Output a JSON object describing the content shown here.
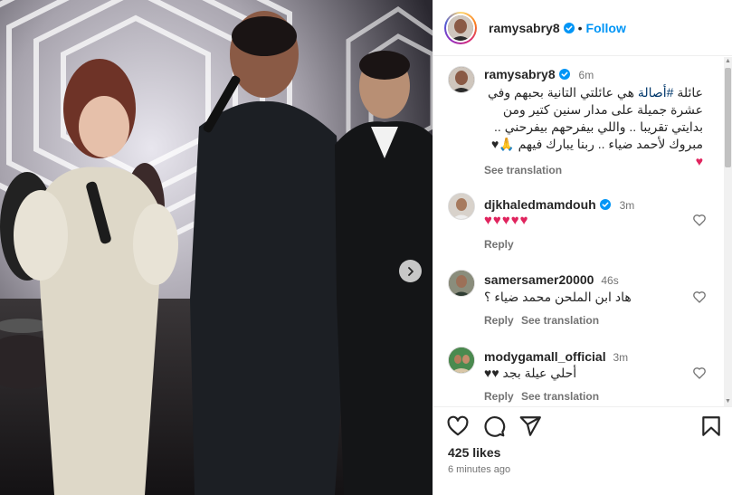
{
  "post": {
    "username": "ramysabry8",
    "follow_label": "Follow",
    "dot": "•",
    "caption_time": "6m",
    "caption": {
      "hashtag": "#أصالة",
      "line1_rest": "عائلة",
      "line1_end": "هي عائلتي التانية بحبهم وفي",
      "line2": "عشرة جميلة على مدار سنين كتير ومن",
      "line3": "بدايتي تقريبا .. واللي بيفرحهم بيفرحني ..",
      "line4": "مبروك لأحمد ضياء .. ربنا يبارك فيهم 🙏♥",
      "line5": "♥"
    },
    "see_translation": "See translation",
    "likes": "425 likes",
    "posted_time": "6 minutes ago"
  },
  "comments": [
    {
      "username": "djkhaledmamdouh",
      "verified": true,
      "time": "3m",
      "text": "♥♥♥♥♥",
      "reply": "Reply",
      "see_translation": ""
    },
    {
      "username": "samersamer20000",
      "verified": false,
      "time": "46s",
      "text": "هاد ابن الملحن محمد ضياء ؟",
      "reply": "Reply",
      "see_translation": "See translation"
    },
    {
      "username": "modygamall_official",
      "verified": false,
      "time": "3m",
      "text": "أحلي عيلة بجد ♥♥",
      "reply": "Reply",
      "see_translation": "See translation"
    }
  ],
  "icons": {
    "verified": "verified-badge-icon",
    "like": "heart-outline-icon",
    "comment": "comment-icon",
    "share": "share-icon",
    "save": "bookmark-icon",
    "next": "chevron-right-icon"
  },
  "colors": {
    "accent": "#0095f6",
    "heart": "#e0245e",
    "secondary_text": "#737373"
  }
}
